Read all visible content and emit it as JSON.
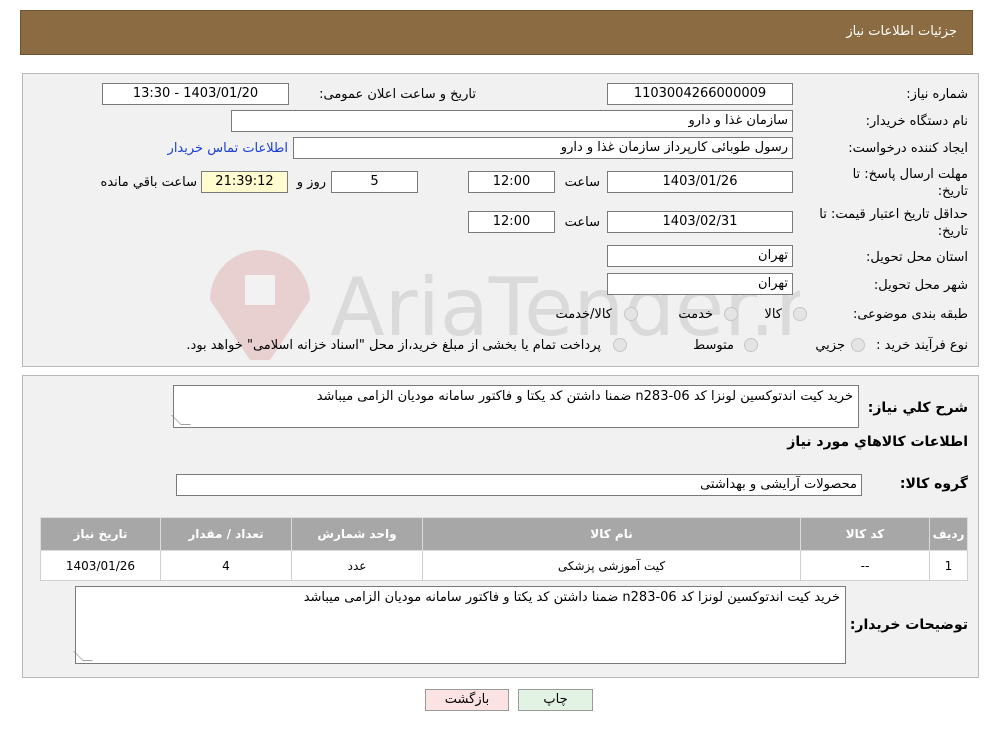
{
  "header": {
    "title": "جزئیات اطلاعات نیاز"
  },
  "fields": {
    "need_number_label": "شماره نیاز:",
    "need_number": "1103004266000009",
    "announce_label": "تاریخ و ساعت اعلان عمومی:",
    "announce_value": "1403/01/20 - 13:30",
    "buyer_org_label": "نام دستگاه خریدار:",
    "buyer_org": "سازمان غذا و دارو",
    "creator_label": "ایجاد کننده درخواست:",
    "creator": "رسول طوبائی کارپرداز سازمان غذا و دارو",
    "contact_link": "اطلاعات تماس خریدار",
    "reply_deadline_label": "مهلت ارسال پاسخ: تا تاریخ:",
    "reply_date": "1403/01/26",
    "time_word": "ساعت",
    "reply_time": "12:00",
    "days_value": "5",
    "days_word": "روز و",
    "remaining_time": "21:39:12",
    "remaining_word": "ساعت باقي مانده",
    "price_validity_label": "حداقل تاریخ اعتبار قیمت: تا تاریخ:",
    "price_date": "1403/02/31",
    "price_time": "12:00",
    "province_label": "استان محل تحویل:",
    "province": "تهران",
    "city_label": "شهر محل تحویل:",
    "city": "تهران",
    "category_label": "طبقه بندی موضوعی:",
    "category_options": [
      "کالا",
      "خدمت",
      "کالا/خدمت"
    ],
    "process_label": "نوع فرآیند خرید :",
    "process_options": [
      "جزیي",
      "متوسط"
    ],
    "process_note": "پرداخت تمام یا بخشی از مبلغ خرید،از محل \"اسناد خزانه اسلامی\" خواهد بود."
  },
  "details": {
    "description_label": "شرح کلي نياز:",
    "description": "خرید کیت اندتوکسین لونزا کد n283-06 ضمنا داشتن کد یکتا و فاکتور سامانه مودیان الزامی میباشد",
    "goods_info_title": "اطلاعات کالاهاي مورد نياز",
    "goods_group_label": "گروه کالا:",
    "goods_group": "محصولات آرایشی و بهداشتی",
    "table": {
      "headers": [
        "رديف",
        "کد کالا",
        "نام کالا",
        "واحد شمارش",
        "تعداد / مقدار",
        "تاریخ نیاز"
      ],
      "rows": [
        [
          "1",
          "--",
          "کیت آموزشی پزشکی",
          "عدد",
          "4",
          "1403/01/26"
        ]
      ]
    },
    "buyer_notes_label": "توضيحات خريدار:",
    "buyer_notes": "خرید کیت اندتوکسین لونزا کد n283-06 ضمنا داشتن کد یکتا و فاکتور سامانه مودیان الزامی میباشد"
  },
  "buttons": {
    "print": "چاپ",
    "back": "بازگشت"
  },
  "watermark_text": "AriaTender.neT",
  "colors": {
    "header_bg": "#8b6b42",
    "table_header_bg": "#a7a7a7",
    "yellow_box": "#fffccf",
    "back_button": "#fbe3e3",
    "print_button": "#e3f3e3"
  }
}
